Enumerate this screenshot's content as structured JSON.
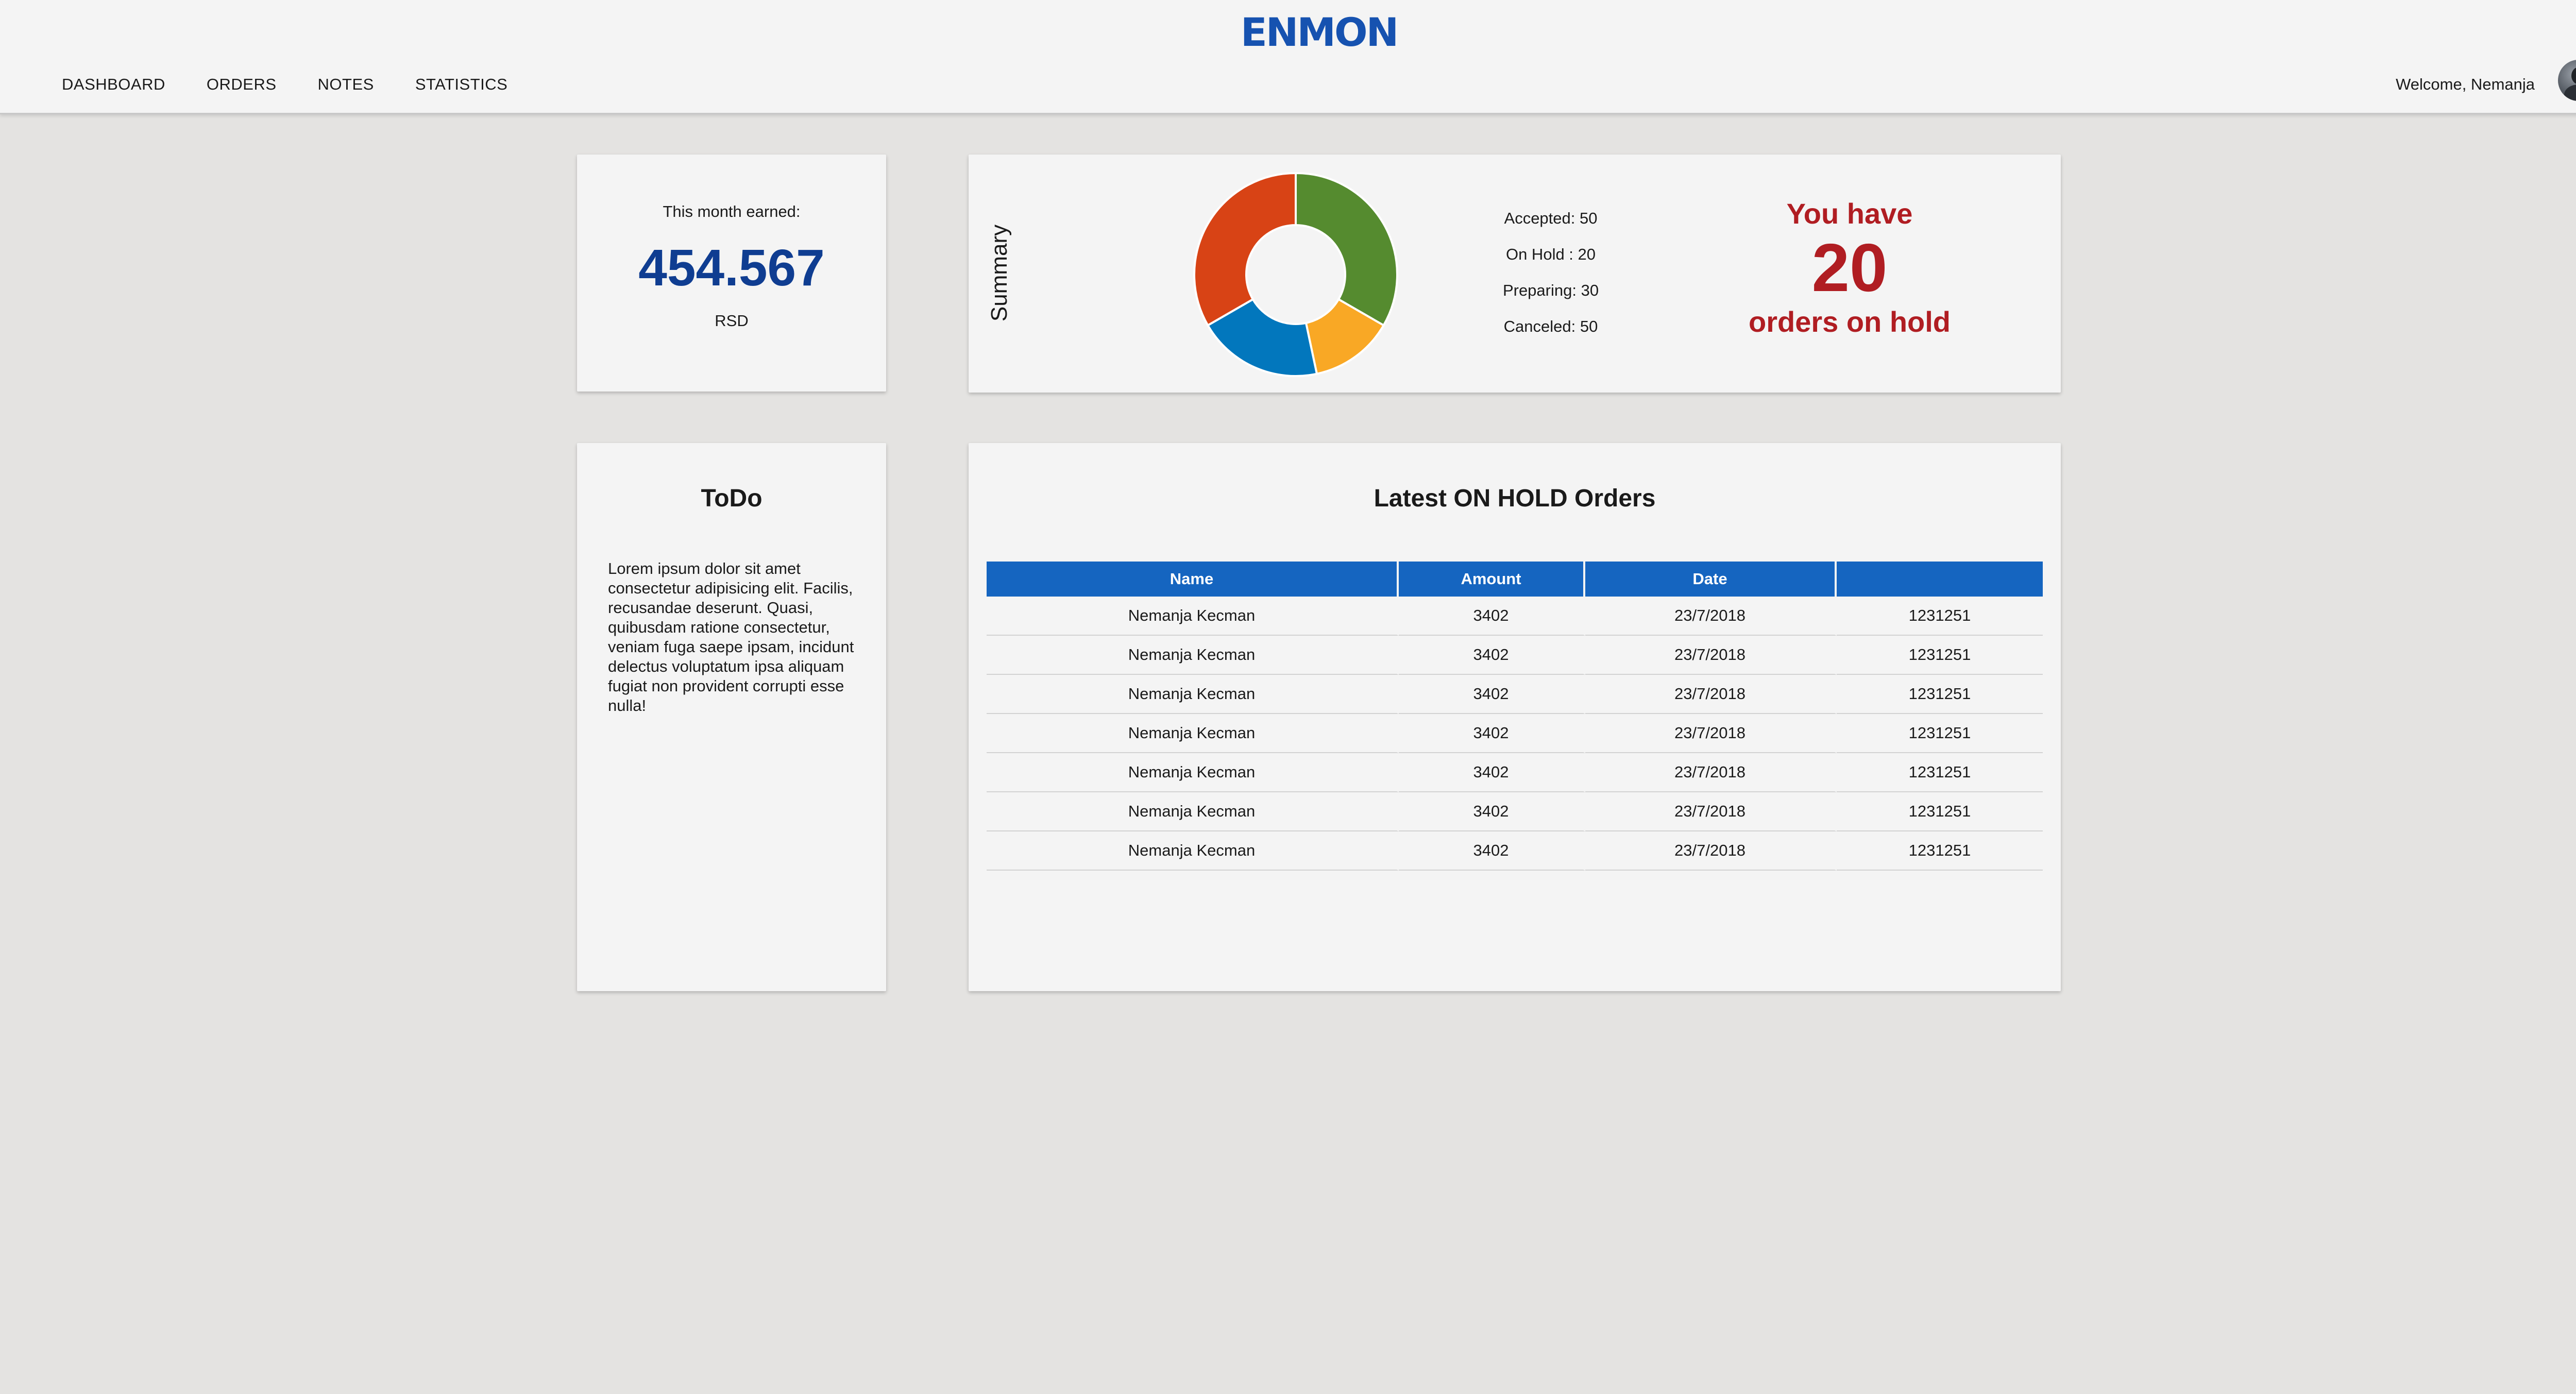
{
  "header": {
    "logo": "ENMON",
    "nav": [
      "DASHBOARD",
      "ORDERS",
      "NOTES",
      "STATISTICS"
    ],
    "welcome": "Welcome, Nemanja",
    "avatar_icon": "user-avatar"
  },
  "earned": {
    "label": "This month earned:",
    "value": "454.567",
    "currency": "RSD"
  },
  "summary": {
    "title": "Summary",
    "legend": [
      "Accepted: 50",
      "On Hold : 20",
      "Preparing: 30",
      "Canceled: 50"
    ],
    "hold_pre": "You have",
    "hold_count": "20",
    "hold_post": "orders on hold"
  },
  "chart_data": {
    "type": "pie",
    "categories": [
      "Accepted",
      "On Hold",
      "Preparing",
      "Canceled"
    ],
    "values": [
      50,
      20,
      30,
      50
    ],
    "colors": [
      "#558b2f",
      "#f9a825",
      "#0277bd",
      "#d84315"
    ]
  },
  "todo": {
    "title": "ToDo",
    "text": "Lorem ipsum dolor sit amet consectetur adipisicing elit. Facilis, recusandae deserunt. Quasi, quibusdam ratione consectetur, veniam fuga saepe ipsam, incidunt delectus voluptatum ipsa aliquam fugiat non provident corrupti esse nulla!"
  },
  "orders": {
    "title": "Latest ON HOLD Orders",
    "columns": [
      "Name",
      "Amount",
      "Date",
      ""
    ],
    "rows": [
      [
        "Nemanja Kecman",
        "3402",
        "23/7/2018",
        "1231251"
      ],
      [
        "Nemanja Kecman",
        "3402",
        "23/7/2018",
        "1231251"
      ],
      [
        "Nemanja Kecman",
        "3402",
        "23/7/2018",
        "1231251"
      ],
      [
        "Nemanja Kecman",
        "3402",
        "23/7/2018",
        "1231251"
      ],
      [
        "Nemanja Kecman",
        "3402",
        "23/7/2018",
        "1231251"
      ],
      [
        "Nemanja Kecman",
        "3402",
        "23/7/2018",
        "1231251"
      ],
      [
        "Nemanja Kecman",
        "3402",
        "23/7/2018",
        "1231251"
      ]
    ]
  }
}
